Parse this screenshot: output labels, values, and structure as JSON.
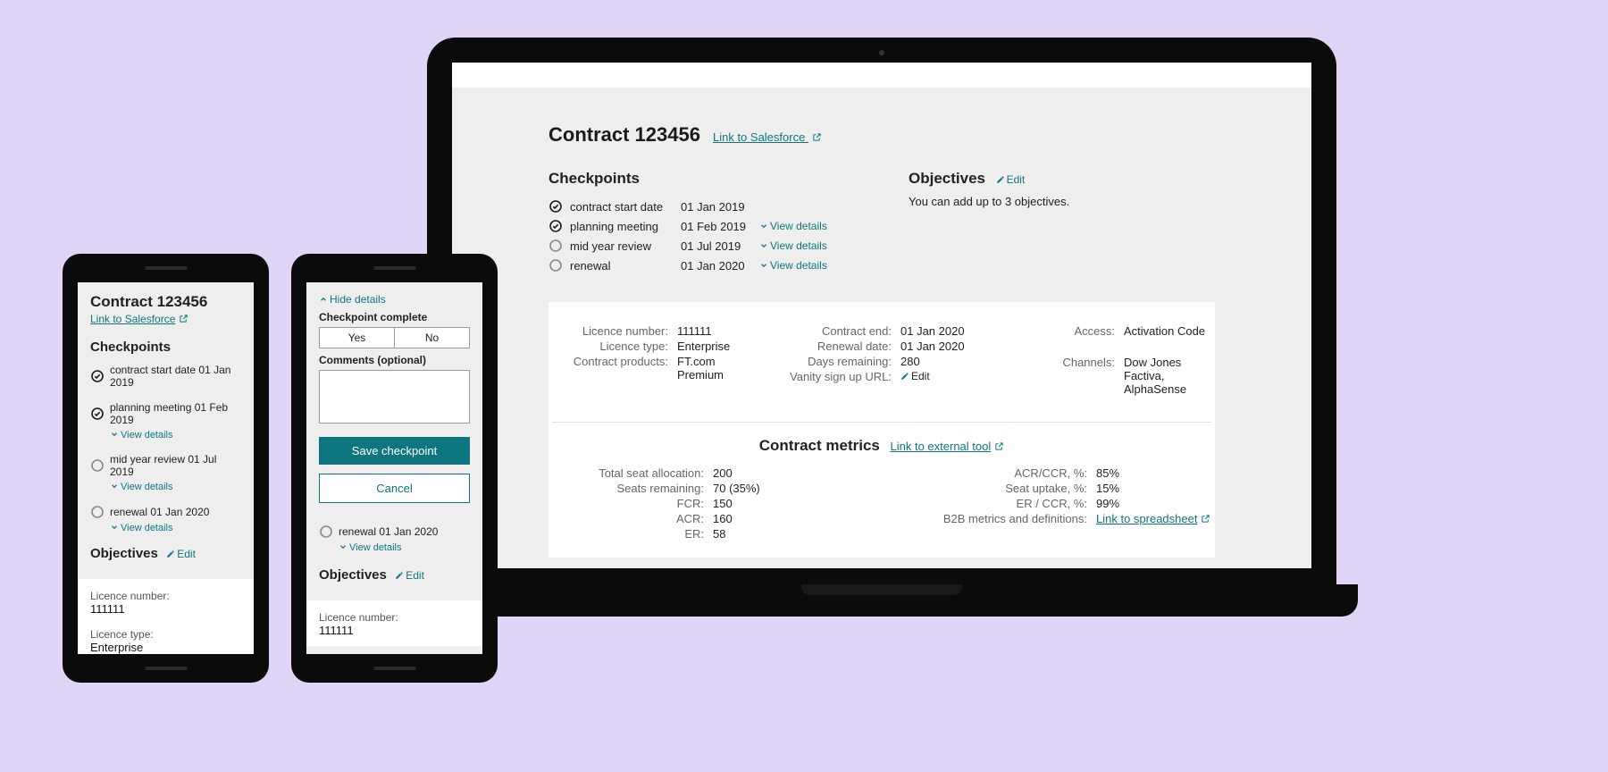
{
  "contract": {
    "title": "Contract 123456",
    "salesforce_link": "Link to Salesforce"
  },
  "checkpoints": {
    "heading": "Checkpoints",
    "view_details": "View details",
    "hide_details": "Hide details",
    "items": [
      {
        "label": "contract start date",
        "date": "01 Jan 2019",
        "done": true,
        "has_details": false
      },
      {
        "label": "planning meeting",
        "date": "01 Feb 2019",
        "done": true,
        "has_details": true
      },
      {
        "label": "mid year review",
        "date": "01 Jul 2019",
        "done": false,
        "has_details": true
      },
      {
        "label": "renewal",
        "date": "01 Jan 2020",
        "done": false,
        "has_details": true
      }
    ]
  },
  "objectives": {
    "heading": "Objectives",
    "edit": "Edit",
    "hint": "You can add up to 3 objectives."
  },
  "info": {
    "licence_number": {
      "label": "Licence number:",
      "value": "111111"
    },
    "licence_type": {
      "label": "Licence type:",
      "value": "Enterprise"
    },
    "contract_products": {
      "label": "Contract products:",
      "value": "FT.com  Premium"
    },
    "contract_end": {
      "label": "Contract end:",
      "value": "01 Jan 2020"
    },
    "renewal_date": {
      "label": "Renewal date:",
      "value": "01 Jan 2020"
    },
    "days_remaining": {
      "label": "Days remaining:",
      "value": "280"
    },
    "vanity_url": {
      "label": "Vanity sign up URL:",
      "value": "Edit"
    },
    "access": {
      "label": "Access:",
      "value": "Activation Code"
    },
    "channels": {
      "label": "Channels:",
      "value": "Dow Jones Factiva, AlphaSense"
    }
  },
  "metrics": {
    "heading": "Contract metrics",
    "ext_link": "Link to external tool",
    "spreadsheet_link": "Link to spreadsheet",
    "left": {
      "total_seat": {
        "label": "Total seat allocation:",
        "value": "200"
      },
      "seats_rem": {
        "label": "Seats remaining:",
        "value": "70 (35%)"
      },
      "fcr": {
        "label": "FCR:",
        "value": "150"
      },
      "acr": {
        "label": "ACR:",
        "value": "160"
      },
      "er": {
        "label": "ER:",
        "value": "58"
      }
    },
    "right": {
      "acr_ccr": {
        "label": "ACR/CCR, %:",
        "value": "85%"
      },
      "seat_uptake": {
        "label": "Seat uptake, %:",
        "value": "15%"
      },
      "er_ccr": {
        "label": "ER / CCR, %:",
        "value": "99%"
      },
      "defs": {
        "label": "B2B metrics and definitions:"
      }
    }
  },
  "form": {
    "complete_label": "Checkpoint complete",
    "yes": "Yes",
    "no": "No",
    "comments_label": "Comments (optional)",
    "save": "Save checkpoint",
    "cancel": "Cancel"
  }
}
